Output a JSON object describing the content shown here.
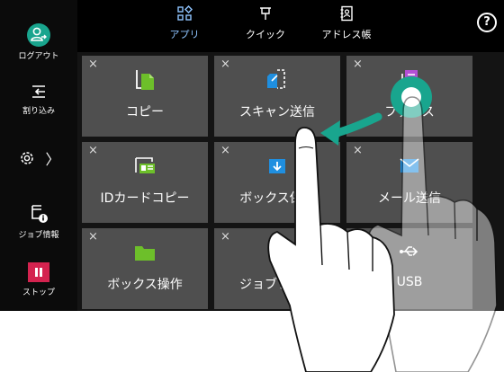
{
  "sidebar": {
    "logout_label": "ログアウト",
    "interrupt_label": "割り込み",
    "settings_arrow": "〉",
    "job_info_label": "ジョブ情報",
    "stop_label": "ストップ"
  },
  "tabs": [
    {
      "label": "アプリ",
      "active": true
    },
    {
      "label": "クイック",
      "active": false
    },
    {
      "label": "アドレス帳",
      "active": false
    }
  ],
  "help_glyph": "?",
  "tiles": [
    {
      "label": "コピー",
      "close": "×",
      "icon": "copy-icon"
    },
    {
      "label": "スキャン送信",
      "close": "×",
      "icon": "scan-send-icon"
    },
    {
      "label": "ファクス",
      "close": "×",
      "icon": "fax-icon"
    },
    {
      "label": "IDカードコピー",
      "close": "×",
      "icon": "id-card-copy-icon"
    },
    {
      "label": "ボックス保存",
      "close": "×",
      "icon": "box-save-icon"
    },
    {
      "label": "メール送信",
      "close": "×",
      "icon": "mail-icon"
    },
    {
      "label": "ボックス操作",
      "close": "×",
      "icon": "folder-icon"
    },
    {
      "label": "ジョブフロー",
      "close": "×",
      "icon": "job-flow-icon"
    },
    {
      "label": "USB",
      "close": "×",
      "icon": "usb-icon"
    }
  ],
  "colors": {
    "tile_bg": "#4f4f4f",
    "accent_teal": "#19a58e",
    "accent_blue": "#1f8fe0",
    "stop_red": "#d4234f",
    "folder_green": "#6dbf2a",
    "active_tab": "#8fc4ff"
  }
}
